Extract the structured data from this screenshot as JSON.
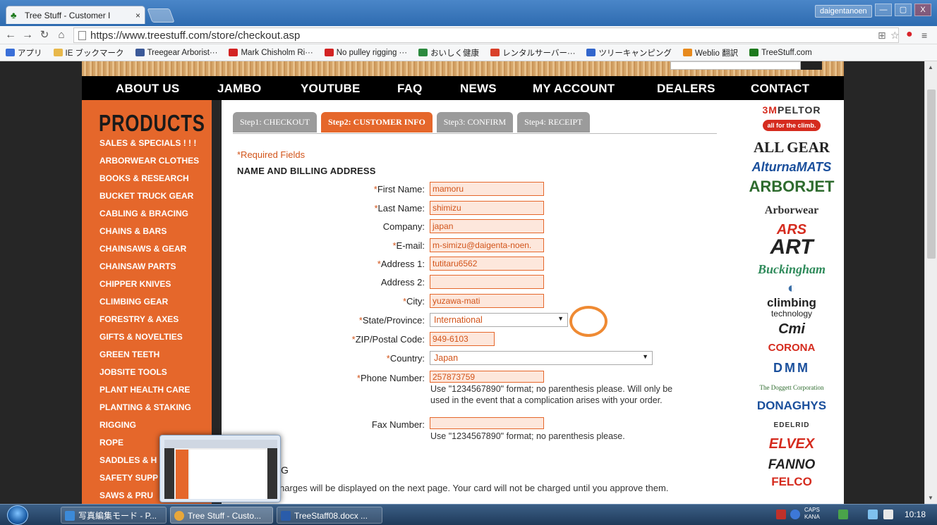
{
  "browser": {
    "tab_title": "Tree Stuff - Customer I",
    "tab_close": "×",
    "user_name": "daigentanoen",
    "url": "https://www.treestuff.com/store/checkout.asp",
    "win_min": "—",
    "win_max": "▢",
    "win_close": "X",
    "bookmarks": [
      {
        "label": "アプリ",
        "icon": "apps-grid-icon",
        "color": "#3a6fd8"
      },
      {
        "label": "IE ブックマーク",
        "icon": "folder-icon",
        "color": "#e8b84a"
      },
      {
        "label": "Treegear Arborist···",
        "icon": "facebook-icon",
        "color": "#3b5998"
      },
      {
        "label": "Mark Chisholm Ri···",
        "icon": "youtube-icon",
        "color": "#d32323"
      },
      {
        "label": "No pulley rigging ···",
        "icon": "youtube-icon",
        "color": "#d32323"
      },
      {
        "label": "おいしく健康",
        "icon": "site-icon",
        "color": "#2c8a3e"
      },
      {
        "label": "レンタルサーバー···",
        "icon": "site-icon",
        "color": "#d9402a"
      },
      {
        "label": "ツリーキャンピング",
        "icon": "site-icon",
        "color": "#3366cc"
      },
      {
        "label": "Weblio 翻訳",
        "icon": "weblio-icon",
        "color": "#e78a1d"
      },
      {
        "label": "TreeStuff.com",
        "icon": "tree-icon",
        "color": "#1e7a1e"
      }
    ]
  },
  "site": {
    "nav": [
      "ABOUT US",
      "JAMBO",
      "YOUTUBE",
      "FAQ",
      "NEWS",
      "MY ACCOUNT",
      "DEALERS",
      "CONTACT"
    ],
    "products_heading": "PRODUCTS",
    "categories": [
      "SALES & SPECIALS ! ! !",
      "ARBORWEAR CLOTHES",
      "BOOKS & RESEARCH",
      "BUCKET TRUCK GEAR",
      "CABLING & BRACING",
      "CHAINS & BARS",
      "CHAINSAWS & GEAR",
      "CHAINSAW PARTS",
      "CHIPPER KNIVES",
      "CLIMBING GEAR",
      "FORESTRY & AXES",
      "GIFTS & NOVELTIES",
      "GREEN TEETH",
      "JOBSITE TOOLS",
      "PLANT HEALTH CARE",
      "PLANTING & STAKING",
      "RIGGING",
      "ROPE",
      "SADDLES & H",
      "SAFETY SUPP",
      "SAWS & PRU"
    ],
    "brands": [
      "PELTOR",
      "all for the climb.",
      "ALL GEAR",
      "AlturnaMATS",
      "ARBORJET",
      "Arborwear",
      "ARS",
      "ART",
      "Buckingham",
      "climbing",
      "technology",
      "Cmi",
      "CORONA",
      "DMM",
      "The Doggett Corporation",
      "DONAGHYS",
      "EDELRID",
      "ELVEX",
      "FANNO",
      "FELCO"
    ],
    "brand_colors": {
      "accent": "#e5672b",
      "dark_green": "#2e6b2e",
      "blue": "#1a4f9c",
      "red": "#d52b1e"
    }
  },
  "checkout": {
    "steps": [
      "Step1: CHECKOUT",
      "Step2: CUSTOMER INFO",
      "Step3: CONFIRM",
      "Step4: RECEIPT"
    ],
    "active_step": 1,
    "required_note": "*Required Fields",
    "section_title": "NAME AND BILLING ADDRESS",
    "fields": {
      "first_name": {
        "label": "First Name:",
        "value": "mamoru",
        "required": "*"
      },
      "last_name": {
        "label": "Last Name:",
        "value": "shimizu",
        "required": "*"
      },
      "company": {
        "label": "Company:",
        "value": "japan"
      },
      "email": {
        "label": "E-mail:",
        "value": "m-simizu@daigenta-noen.",
        "required": "*"
      },
      "address1": {
        "label": "Address 1:",
        "value": "tutitaru6562",
        "required": "*"
      },
      "address2": {
        "label": "Address 2:",
        "value": ""
      },
      "city": {
        "label": "City:",
        "value": "yuzawa-mati",
        "required": "*"
      },
      "state": {
        "label": "State/Province:",
        "value": "International",
        "required": "*"
      },
      "zip": {
        "label": "ZIP/Postal Code:",
        "value": "949-6103",
        "required": "*"
      },
      "country": {
        "label": "Country:",
        "value": "Japan",
        "required": "*"
      },
      "phone": {
        "label": "Phone Number:",
        "value": "257873759",
        "required": "*"
      },
      "fax": {
        "label": "Fax Number:",
        "value": ""
      }
    },
    "phone_help_1": "Use \"1234567890\" format; no parenthesis please. Will only be",
    "phone_help_2": "used in the event that a complication arises with your order.",
    "fax_help": "Use \"1234567890\" format; no parenthesis please.",
    "shipping_fragment": "G",
    "charges_note": "harges will be displayed on the next page. Your card will not be charged until you approve them."
  },
  "taskbar": {
    "items": [
      {
        "label": "写真編集モード - P...",
        "icon": "photo-editor-icon",
        "color": "#3c8ad8"
      },
      {
        "label": "Tree Stuff - Custo...",
        "icon": "chrome-icon",
        "color": "#e8a73a"
      },
      {
        "label": "TreeStaff08.docx ...",
        "icon": "word-icon",
        "color": "#2a5caa"
      }
    ],
    "caps": "CAPS",
    "kana": "KANA",
    "time": "10:18"
  }
}
